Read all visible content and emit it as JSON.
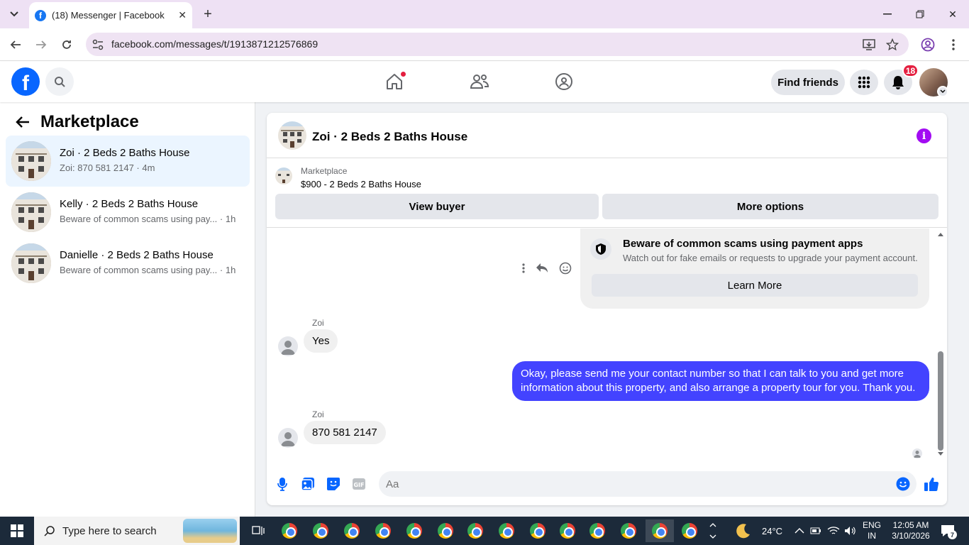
{
  "browser": {
    "tab_title": "(18) Messenger | Facebook",
    "url": "facebook.com/messages/t/1913871212576869"
  },
  "fb_header": {
    "find_friends_label": "Find friends",
    "notification_count": "18"
  },
  "sidebar": {
    "title": "Marketplace",
    "conversations": [
      {
        "name": "Zoi · 2 Beds 2 Baths House",
        "snippet": "Zoi: 870 581 2147 · 4m",
        "active": true
      },
      {
        "name": "Kelly · 2 Beds 2 Baths House",
        "snippet": "Beware of common scams using pay... · 1h",
        "active": false
      },
      {
        "name": "Danielle · 2 Beds 2 Baths House",
        "snippet": "Beware of common scams using pay... · 1h",
        "active": false
      }
    ]
  },
  "chat": {
    "title": "Zoi · 2 Beds 2 Baths House",
    "marketplace_label": "Marketplace",
    "listing": "$900 - 2 Beds 2 Baths House",
    "view_buyer_label": "View buyer",
    "more_options_label": "More options",
    "scam_card": {
      "title": "Beware of common scams using payment apps",
      "body": "Watch out for fake emails or requests to upgrade your payment account.",
      "button": "Learn More"
    },
    "messages": [
      {
        "sender": "Zoi",
        "text": "Yes",
        "direction": "in"
      },
      {
        "sender": "",
        "text": "Okay, please send me your contact number so that I can talk to you and get more information about this property, and also arrange a property tour for you. Thank you.",
        "direction": "out"
      },
      {
        "sender": "Zoi",
        "text": "870 581 2147",
        "direction": "in"
      }
    ],
    "composer_placeholder": "Aa"
  },
  "taskbar": {
    "search_placeholder": "Type here to search",
    "weather": "24°C",
    "language": "ENG",
    "region": "IN",
    "time": "12:05 AM",
    "date": "3/10/2026",
    "notification_count": "7"
  },
  "colors": {
    "fb_blue": "#0866ff",
    "outgoing_bubble": "#4343ff",
    "info_purple": "#a20cf2",
    "badge_red": "#e41e3f"
  }
}
